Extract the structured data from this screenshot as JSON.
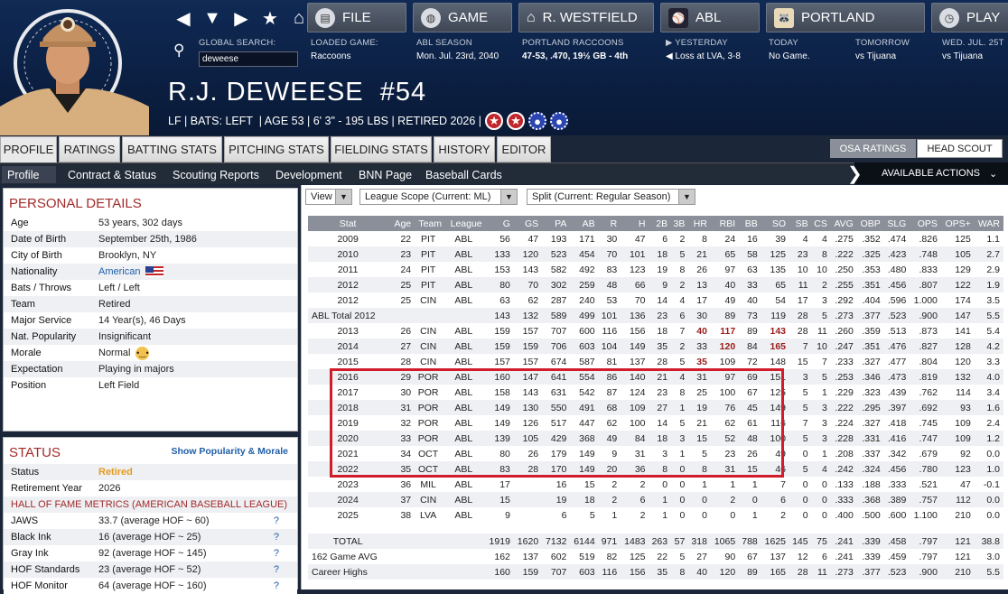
{
  "nav": {
    "file_label": "FILE",
    "game_label": "GAME",
    "manager_label": "R. WESTFIELD",
    "league_label": "ABL",
    "team_label": "PORTLAND",
    "play_label": "PLAY",
    "search_label": "GLOBAL SEARCH:",
    "search_value": "deweese",
    "loaded_game_label": "LOADED GAME:",
    "loaded_game_value": "Raccoons",
    "season_label": "ABL SEASON",
    "season_value": "Mon. Jul. 23rd, 2040",
    "team_record_label": "PORTLAND RACCOONS",
    "team_record_value": "47-53, .470, 19½ GB - 4th",
    "yesterday_label": "YESTERDAY",
    "yesterday_value": "Loss at LVA, 3-8",
    "today_label": "TODAY",
    "today_value": "No Game.",
    "tomorrow_label": "TOMORROW",
    "tomorrow_value": "vs Tijuana",
    "wed_label": "WED. JUL. 25T",
    "wed_value": "vs Tijuana"
  },
  "player": {
    "name": "R.J. DEWEESE",
    "number": "#54",
    "info": "LF | BATS: LEFT  | AGE 53 | 6' 3\" - 195 LBS | RETIRED 2026 |"
  },
  "tabs": [
    "PROFILE",
    "RATINGS",
    "BATTING STATS",
    "PITCHING STATS",
    "FIELDING STATS",
    "HISTORY",
    "EDITOR"
  ],
  "osa_label": "OSA RATINGS",
  "scout_label": "HEAD SCOUT",
  "subtabs": [
    "Profile",
    "Contract & Status",
    "Scouting Reports",
    "Development",
    "BNN Page",
    "Baseball Cards"
  ],
  "actions_label": "AVAILABLE ACTIONS",
  "personal": {
    "title": "PERSONAL DETAILS",
    "rows": [
      {
        "k": "Age",
        "v": "53 years, 302 days"
      },
      {
        "k": "Date of Birth",
        "v": "September 25th, 1986"
      },
      {
        "k": "City of Birth",
        "v": "Brooklyn, NY"
      },
      {
        "k": "Nationality",
        "v": "American"
      },
      {
        "k": "Bats / Throws",
        "v": "Left / Left"
      },
      {
        "k": "Team",
        "v": "Retired"
      },
      {
        "k": "Major Service",
        "v": "14 Year(s), 46 Days"
      },
      {
        "k": "Nat. Popularity",
        "v": "Insignificant"
      },
      {
        "k": "Morale",
        "v": "Normal"
      },
      {
        "k": "Expectation",
        "v": "Playing in majors"
      },
      {
        "k": "Position",
        "v": "Left Field"
      }
    ]
  },
  "status": {
    "title": "STATUS",
    "link": "Show Popularity & Morale",
    "rows": [
      {
        "k": "Status",
        "v": "Retired"
      },
      {
        "k": "Retirement Year",
        "v": "2026"
      }
    ],
    "hof_title": "HALL OF FAME METRICS (AMERICAN BASEBALL LEAGUE)",
    "hof": [
      {
        "k": "JAWS",
        "v": "33.7 (average HOF ~ 60)"
      },
      {
        "k": "Black Ink",
        "v": "16 (average HOF ~ 25)"
      },
      {
        "k": "Gray Ink",
        "v": "92 (average HOF ~ 145)"
      },
      {
        "k": "HOF Standards",
        "v": "23 (average HOF ~ 52)"
      },
      {
        "k": "HOF Monitor",
        "v": "64 (average HOF ~ 160)"
      }
    ],
    "q": "?"
  },
  "controls": {
    "view": "View",
    "scope": "League Scope  (Current: ML)",
    "split": "Split  (Current: Regular Season)"
  },
  "stats": {
    "headers": [
      "Stat",
      "Age",
      "Team",
      "League",
      "G",
      "GS",
      "PA",
      "AB",
      "R",
      "H",
      "2B",
      "3B",
      "HR",
      "RBI",
      "BB",
      "SO",
      "SB",
      "CS",
      "AVG",
      "OBP",
      "SLG",
      "OPS",
      "OPS+",
      "WAR"
    ],
    "rows": [
      [
        "2009",
        "22",
        "PIT",
        "ABL",
        "56",
        "47",
        "193",
        "171",
        "30",
        "47",
        "6",
        "2",
        "8",
        "24",
        "16",
        "39",
        "4",
        "4",
        ".275",
        ".352",
        ".474",
        ".826",
        "125",
        "1.1"
      ],
      [
        "2010",
        "23",
        "PIT",
        "ABL",
        "133",
        "120",
        "523",
        "454",
        "70",
        "101",
        "18",
        "5",
        "21",
        "65",
        "58",
        "125",
        "23",
        "8",
        ".222",
        ".325",
        ".423",
        ".748",
        "105",
        "2.7"
      ],
      [
        "2011",
        "24",
        "PIT",
        "ABL",
        "153",
        "143",
        "582",
        "492",
        "83",
        "123",
        "19",
        "8",
        "26",
        "97",
        "63",
        "135",
        "10",
        "10",
        ".250",
        ".353",
        ".480",
        ".833",
        "129",
        "2.9"
      ],
      [
        "2012",
        "25",
        "PIT",
        "ABL",
        "80",
        "70",
        "302",
        "259",
        "48",
        "66",
        "9",
        "2",
        "13",
        "40",
        "33",
        "65",
        "11",
        "2",
        ".255",
        ".351",
        ".456",
        ".807",
        "122",
        "1.9"
      ],
      [
        "2012",
        "25",
        "CIN",
        "ABL",
        "63",
        "62",
        "287",
        "240",
        "53",
        "70",
        "14",
        "4",
        "17",
        "49",
        "40",
        "54",
        "17",
        "3",
        ".292",
        ".404",
        ".596",
        "1.000",
        "174",
        "3.5"
      ],
      [
        "ABL Total 2012",
        "",
        "",
        "",
        "143",
        "132",
        "589",
        "499",
        "101",
        "136",
        "23",
        "6",
        "30",
        "89",
        "73",
        "119",
        "28",
        "5",
        ".273",
        ".377",
        ".523",
        ".900",
        "147",
        "5.5"
      ],
      [
        "2013",
        "26",
        "CIN",
        "ABL",
        "159",
        "157",
        "707",
        "600",
        "116",
        "156",
        "18",
        "7",
        "40",
        "117",
        "89",
        "143",
        "28",
        "11",
        ".260",
        ".359",
        ".513",
        ".873",
        "141",
        "5.4"
      ],
      [
        "2014",
        "27",
        "CIN",
        "ABL",
        "159",
        "159",
        "706",
        "603",
        "104",
        "149",
        "35",
        "2",
        "33",
        "120",
        "84",
        "165",
        "7",
        "10",
        ".247",
        ".351",
        ".476",
        ".827",
        "128",
        "4.2"
      ],
      [
        "2015",
        "28",
        "CIN",
        "ABL",
        "157",
        "157",
        "674",
        "587",
        "81",
        "137",
        "28",
        "5",
        "35",
        "109",
        "72",
        "148",
        "15",
        "7",
        ".233",
        ".327",
        ".477",
        ".804",
        "120",
        "3.3"
      ],
      [
        "2016",
        "29",
        "POR",
        "ABL",
        "160",
        "147",
        "641",
        "554",
        "86",
        "140",
        "21",
        "4",
        "31",
        "97",
        "69",
        "151",
        "3",
        "5",
        ".253",
        ".346",
        ".473",
        ".819",
        "132",
        "4.0"
      ],
      [
        "2017",
        "30",
        "POR",
        "ABL",
        "158",
        "143",
        "631",
        "542",
        "87",
        "124",
        "23",
        "8",
        "25",
        "100",
        "67",
        "125",
        "5",
        "1",
        ".229",
        ".323",
        ".439",
        ".762",
        "114",
        "3.4"
      ],
      [
        "2018",
        "31",
        "POR",
        "ABL",
        "149",
        "130",
        "550",
        "491",
        "68",
        "109",
        "27",
        "1",
        "19",
        "76",
        "45",
        "149",
        "5",
        "3",
        ".222",
        ".295",
        ".397",
        ".692",
        "93",
        "1.6"
      ],
      [
        "2019",
        "32",
        "POR",
        "ABL",
        "149",
        "126",
        "517",
        "447",
        "62",
        "100",
        "14",
        "5",
        "21",
        "62",
        "61",
        "116",
        "7",
        "3",
        ".224",
        ".327",
        ".418",
        ".745",
        "109",
        "2.4"
      ],
      [
        "2020",
        "33",
        "POR",
        "ABL",
        "139",
        "105",
        "429",
        "368",
        "49",
        "84",
        "18",
        "3",
        "15",
        "52",
        "48",
        "100",
        "5",
        "3",
        ".228",
        ".331",
        ".416",
        ".747",
        "109",
        "1.2"
      ],
      [
        "2021",
        "34",
        "OCT",
        "ABL",
        "80",
        "26",
        "179",
        "149",
        "9",
        "31",
        "3",
        "1",
        "5",
        "23",
        "26",
        "49",
        "0",
        "1",
        ".208",
        ".337",
        ".342",
        ".679",
        "92",
        "0.0"
      ],
      [
        "2022",
        "35",
        "OCT",
        "ABL",
        "83",
        "28",
        "170",
        "149",
        "20",
        "36",
        "8",
        "0",
        "8",
        "31",
        "15",
        "46",
        "5",
        "4",
        ".242",
        ".324",
        ".456",
        ".780",
        "123",
        "1.0"
      ],
      [
        "2023",
        "36",
        "MIL",
        "ABL",
        "17",
        "",
        "16",
        "15",
        "2",
        "2",
        "0",
        "0",
        "1",
        "1",
        "1",
        "7",
        "0",
        "0",
        ".133",
        ".188",
        ".333",
        ".521",
        "47",
        "-0.1"
      ],
      [
        "2024",
        "37",
        "CIN",
        "ABL",
        "15",
        "",
        "19",
        "18",
        "2",
        "6",
        "1",
        "0",
        "0",
        "2",
        "0",
        "6",
        "0",
        "0",
        ".333",
        ".368",
        ".389",
        ".757",
        "112",
        "0.0"
      ],
      [
        "2025",
        "38",
        "LVA",
        "ABL",
        "9",
        "",
        "6",
        "5",
        "1",
        "2",
        "1",
        "0",
        "0",
        "0",
        "1",
        "2",
        "0",
        "0",
        ".400",
        ".500",
        ".600",
        "1.100",
        "210",
        "0.0"
      ]
    ],
    "total": [
      "TOTAL",
      "",
      "",
      "",
      "1919",
      "1620",
      "7132",
      "6144",
      "971",
      "1483",
      "263",
      "57",
      "318",
      "1065",
      "788",
      "1625",
      "145",
      "75",
      ".241",
      ".339",
      ".458",
      ".797",
      "121",
      "38.8"
    ],
    "avg162": [
      "162 Game AVG",
      "",
      "",
      "",
      "162",
      "137",
      "602",
      "519",
      "82",
      "125",
      "22",
      "5",
      "27",
      "90",
      "67",
      "137",
      "12",
      "6",
      ".241",
      ".339",
      ".459",
      ".797",
      "121",
      "3.0"
    ],
    "highs": [
      "Career Highs",
      "",
      "",
      "",
      "160",
      "159",
      "707",
      "603",
      "116",
      "156",
      "35",
      "8",
      "40",
      "120",
      "89",
      "165",
      "28",
      "11",
      ".273",
      ".377",
      ".523",
      ".900",
      "210",
      "5.5"
    ]
  }
}
